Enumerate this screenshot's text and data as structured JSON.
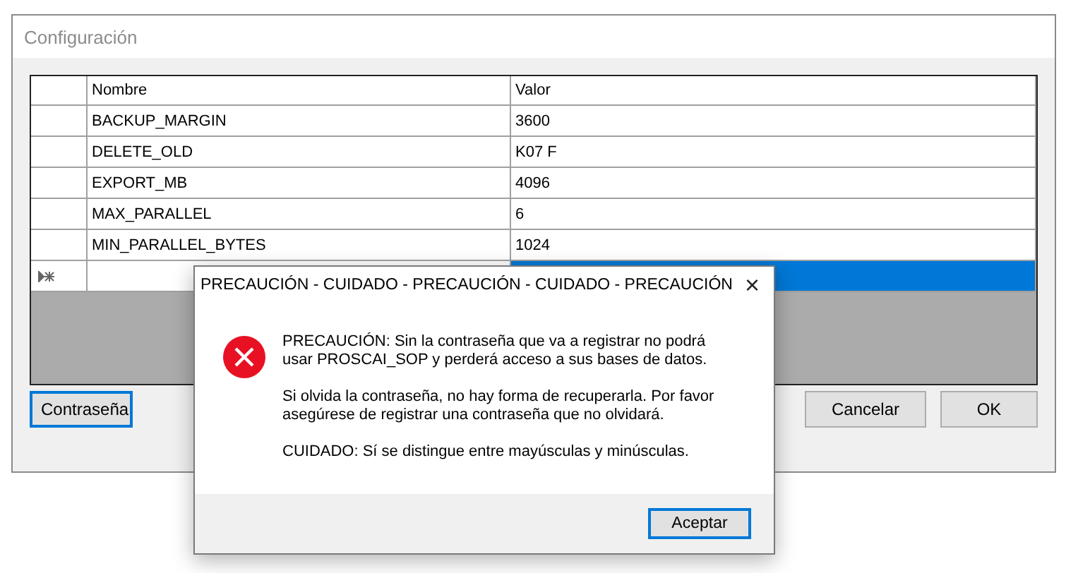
{
  "window": {
    "title": "Configuración"
  },
  "table": {
    "columns": [
      "Nombre",
      "Valor"
    ],
    "rows": [
      {
        "name": "BACKUP_MARGIN",
        "value": "3600"
      },
      {
        "name": "DELETE_OLD",
        "value": "K07 F"
      },
      {
        "name": "EXPORT_MB",
        "value": "4096"
      },
      {
        "name": "MAX_PARALLEL",
        "value": "6"
      },
      {
        "name": "MIN_PARALLEL_BYTES",
        "value": "1024"
      }
    ],
    "new_row": {
      "selected": true
    }
  },
  "buttons": [
    {
      "label": "Contraseña",
      "focused": true
    },
    {
      "label": "Cancelar",
      "focused": false
    },
    {
      "label": "OK",
      "focused": false
    }
  ],
  "dialog": {
    "title": "PRECAUCIÓN - CUIDADO - PRECAUCIÓN - CUIDADO - PRECAUCIÓN",
    "close": "×",
    "paragraphs": [
      "PRECAUCIÓN: Sin la contraseña que va a registrar no podrá usar PROSCAI_SOP y perderá acceso a sus bases de datos.",
      "Si olvida la contraseña, no hay forma de recuperarla. Por favor asegúrese de registrar una contraseña que no olvidará.",
      "CUIDADO: Sí se distingue entre mayúsculas y minúsculas."
    ],
    "button": {
      "label": "Aceptar",
      "focused": true
    }
  }
}
